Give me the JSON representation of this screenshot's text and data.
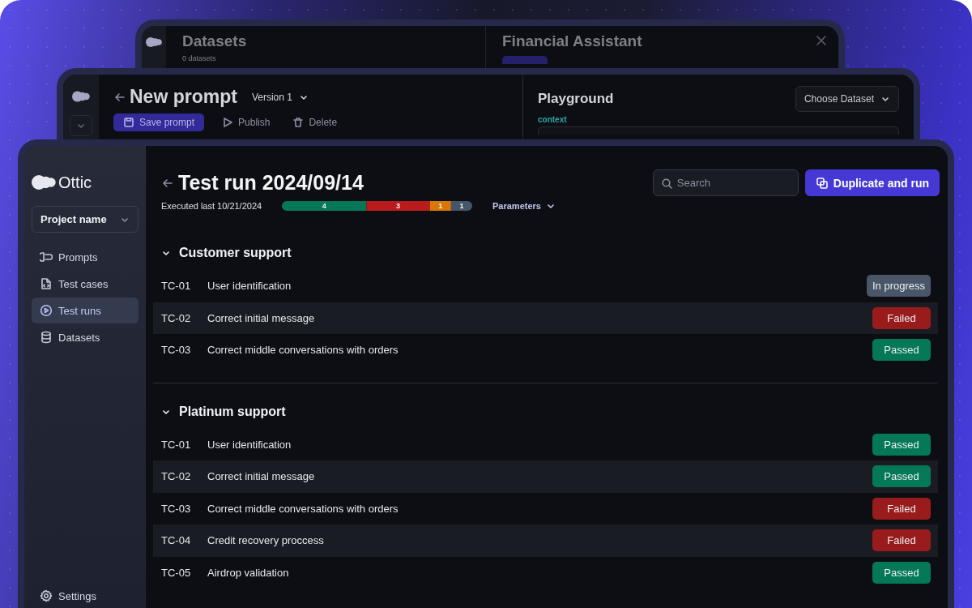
{
  "back_window": {
    "left_title": "Datasets",
    "left_subtitle": "0 datasets",
    "right_title": "Financial Assistant"
  },
  "middle_window": {
    "title": "New prompt",
    "version": "Version 1",
    "actions": [
      {
        "label": "Save prompt",
        "kind": "primary"
      },
      {
        "label": "Publish",
        "kind": "publish"
      },
      {
        "label": "Delete",
        "kind": "delete"
      }
    ],
    "playground": {
      "title": "Playground",
      "dataset_select": "Choose Dataset",
      "field_label": "context"
    }
  },
  "app": {
    "logo": "Ottic",
    "project": "Project name",
    "nav": [
      {
        "label": "Prompts",
        "selected": false
      },
      {
        "label": "Test cases",
        "selected": false
      },
      {
        "label": "Test runs",
        "selected": true
      },
      {
        "label": "Datasets",
        "selected": false
      }
    ],
    "settings": "Settings",
    "title": "Test run 2024/09/14",
    "search": {
      "placeholder": "Search"
    },
    "primary_button": "Duplicate and run",
    "executed": "Executed last 10/21/2024",
    "summary": {
      "chart_data": {
        "type": "bar",
        "orientation": "horizontal",
        "stacked": true,
        "data_labels": true,
        "series": [
          {
            "color": "#047857",
            "values": [
              4
            ]
          },
          {
            "color": "#b91c1c",
            "values": [
              3
            ]
          },
          {
            "color": "#d97706",
            "values": [
              1
            ]
          },
          {
            "color": "#475569",
            "values": [
              1
            ]
          }
        ]
      }
    },
    "parameters": "Parameters",
    "groups": [
      {
        "name": "Customer support",
        "expanded": true,
        "rows": [
          {
            "id": "TC-01",
            "name": "User identification",
            "status": "In progress",
            "kind": "progress"
          },
          {
            "id": "TC-02",
            "name": "Correct initial message",
            "status": "Failed",
            "kind": "failed"
          },
          {
            "id": "TC-03",
            "name": "Correct middle conversations with orders",
            "status": "Passed",
            "kind": "passed"
          }
        ]
      },
      {
        "name": "Platinum support",
        "expanded": true,
        "rows": [
          {
            "id": "TC-01",
            "name": "User identification",
            "status": "Passed",
            "kind": "passed"
          },
          {
            "id": "TC-02",
            "name": "Correct initial message",
            "status": "Passed",
            "kind": "passed"
          },
          {
            "id": "TC-03",
            "name": "Correct middle conversations with orders",
            "status": "Failed",
            "kind": "failed"
          },
          {
            "id": "TC-04",
            "name": "Credit recovery proccess",
            "status": "Failed",
            "kind": "failed"
          },
          {
            "id": "TC-05",
            "name": "Airdrop validation",
            "status": "Passed",
            "kind": "passed"
          }
        ]
      }
    ]
  }
}
